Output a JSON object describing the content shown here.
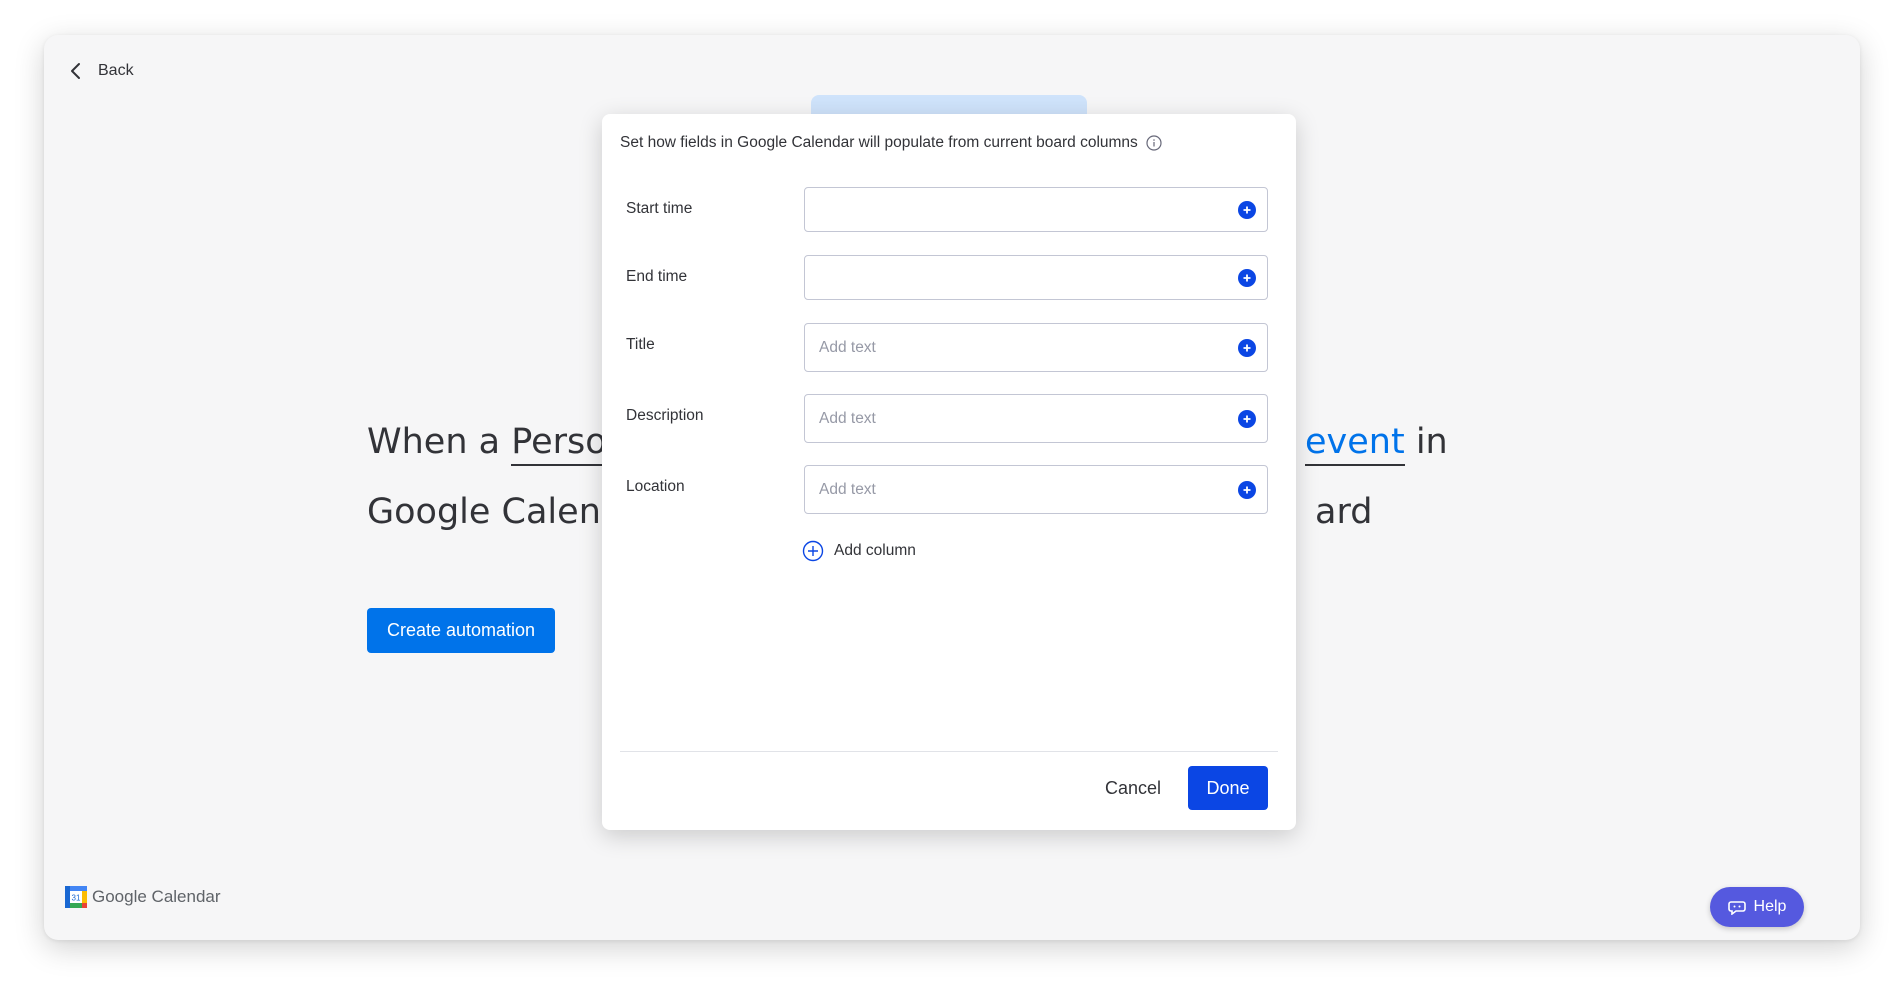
{
  "nav": {
    "back_label": "Back"
  },
  "sentence": {
    "line1_left_plain": "When a ",
    "line1_left_underlined": "Persor",
    "line1_right_blue": "event",
    "line1_right_plain": " in",
    "line2_left": "Google Calenc",
    "line2_right": "ard"
  },
  "create_button_label": "Create automation",
  "brand": {
    "name": "Google Calendar",
    "logo_day": "31"
  },
  "help_label": "Help",
  "modal": {
    "heading": "Set how fields in Google Calendar will populate from current board columns",
    "fields": [
      {
        "label": "Start time",
        "placeholder": ""
      },
      {
        "label": "End time",
        "placeholder": ""
      },
      {
        "label": "Title",
        "placeholder": "Add text"
      },
      {
        "label": "Description",
        "placeholder": "Add text"
      },
      {
        "label": "Location",
        "placeholder": "Add text"
      }
    ],
    "add_column_label": "Add column",
    "cancel_label": "Cancel",
    "done_label": "Done"
  },
  "colors": {
    "primary_blue": "#0073ea",
    "modal_blue": "#0b46e4",
    "help_purple": "#5559df"
  }
}
